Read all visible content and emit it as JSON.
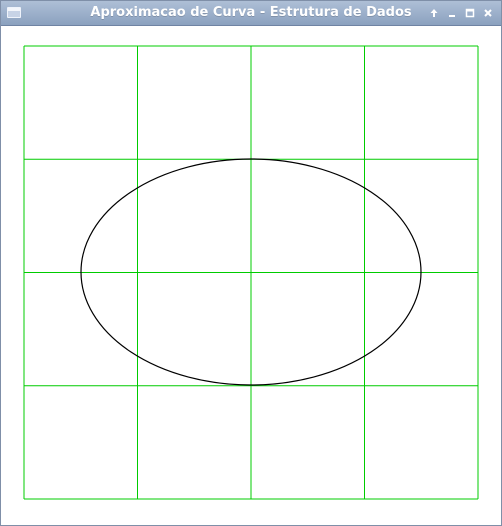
{
  "window": {
    "title": "Aproximacao de Curva - Estrutura de Dados",
    "icons": {
      "app": "window-icon",
      "shade": "arrow-up-icon",
      "minimize": "minimize-icon",
      "maximize": "maximize-icon",
      "close": "close-icon"
    }
  },
  "plot": {
    "grid_color": "#00cc00",
    "curve_color": "#000000",
    "grid_columns": 4,
    "grid_rows": 4,
    "curve": "ellipse"
  }
}
